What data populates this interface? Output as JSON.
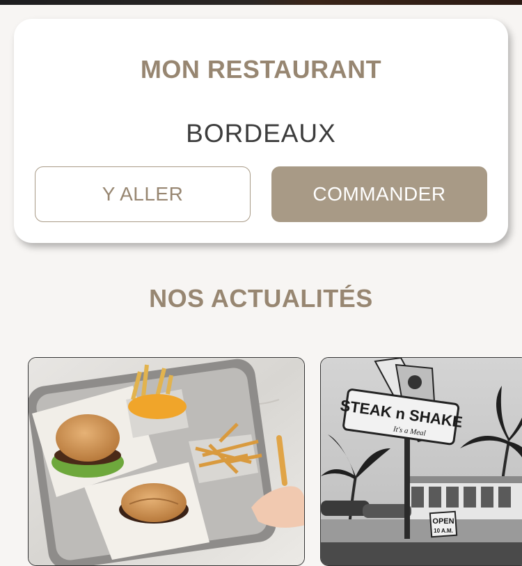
{
  "restaurant_card": {
    "title": "MON RESTAURANT",
    "city": "BORDEAUX",
    "go_button": "Y ALLER",
    "order_button": "COMMANDER"
  },
  "news": {
    "title": "NOS ACTUALITÉS",
    "items": [
      {
        "image": "burgers-and-fries-tray-photo"
      },
      {
        "image": "steak-n-shake-vintage-sign-photo",
        "sign_text": "STEAK n SHAKE",
        "sign_subtext": "It's a Meal",
        "open_sign": "OPEN",
        "open_hours": "10 A.M."
      }
    ]
  },
  "colors": {
    "accent": "#978671",
    "button_fill": "#a89a86",
    "city_text": "#3c3c3c",
    "background": "#f7f5f3"
  }
}
